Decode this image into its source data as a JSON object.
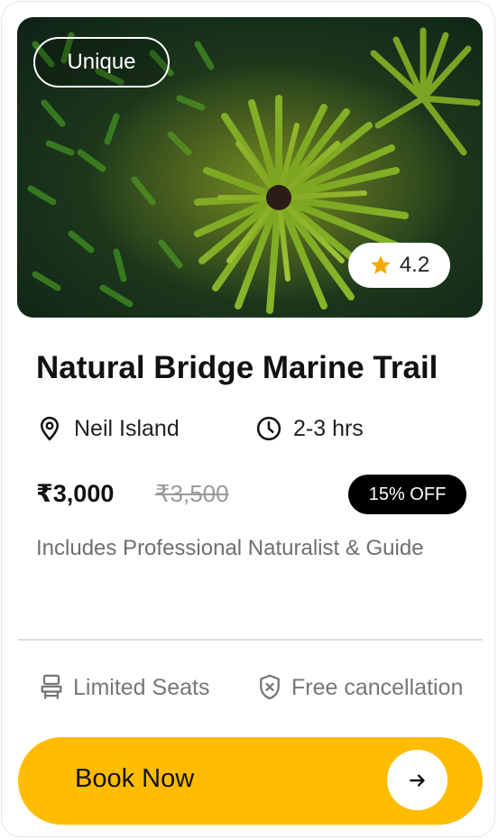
{
  "card": {
    "tag": "Unique",
    "rating": "4.2",
    "title": "Natural Bridge Marine Trail",
    "location": "Neil Island",
    "duration": "2-3 hrs",
    "price": "₹3,000",
    "old_price": "₹3,500",
    "discount": "15% OFF",
    "description": "Includes Professional Naturalist & Guide",
    "features": [
      {
        "label": "Limited Seats",
        "icon": "seat-icon"
      },
      {
        "label": "Free cancellation",
        "icon": "shield-x-icon"
      }
    ],
    "cta": "Book Now"
  },
  "colors": {
    "accent": "#ffbc00",
    "discount_bg": "#000000",
    "star": "#f5a800",
    "muted_text": "#6f6f6f"
  }
}
